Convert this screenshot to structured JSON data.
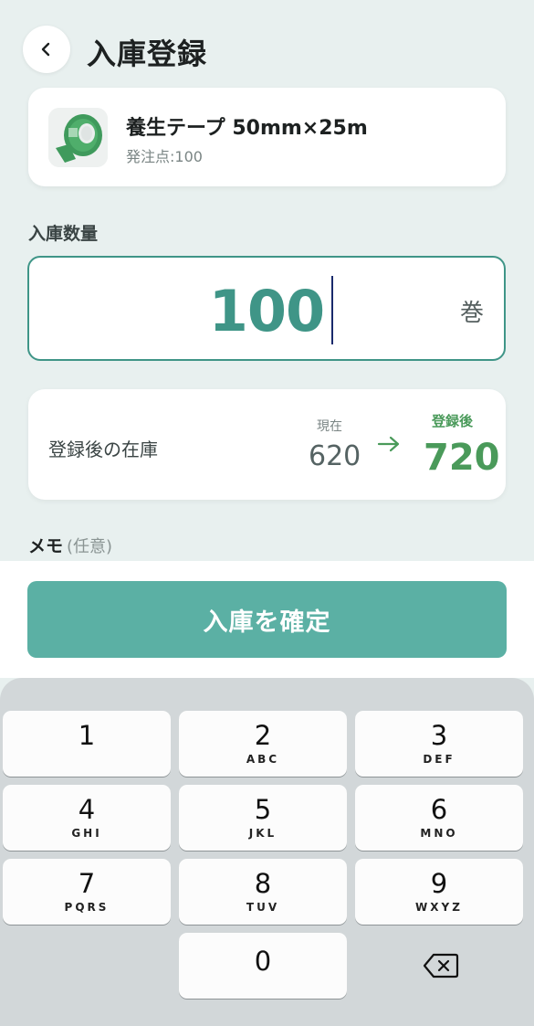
{
  "header": {
    "title": "入庫登録",
    "back_icon": "chevron-left-icon"
  },
  "product": {
    "name": "養生テープ 50mm×25m",
    "reorder_point": "発注点:100",
    "thumbnail_icon": "tape-roll-image",
    "thumbnail_color": "#3f9a5c"
  },
  "quantity": {
    "label": "入庫数量",
    "value": "100",
    "unit": "巻"
  },
  "stock": {
    "label": "登録後の在庫",
    "current_label": "現在",
    "current_value": "620",
    "after_label": "登録後",
    "after_value": "720",
    "arrow_icon": "arrow-right-icon"
  },
  "memo": {
    "label": "メモ",
    "optional": "(任意)"
  },
  "confirm": {
    "label": "入庫を確定"
  },
  "keypad": {
    "keys": [
      {
        "digit": "1",
        "letters": ""
      },
      {
        "digit": "2",
        "letters": "ABC"
      },
      {
        "digit": "3",
        "letters": "DEF"
      },
      {
        "digit": "4",
        "letters": "GHI"
      },
      {
        "digit": "5",
        "letters": "JKL"
      },
      {
        "digit": "6",
        "letters": "MNO"
      },
      {
        "digit": "7",
        "letters": "PQRS"
      },
      {
        "digit": "8",
        "letters": "TUV"
      },
      {
        "digit": "9",
        "letters": "WXYZ"
      },
      {
        "digit": "0",
        "letters": ""
      }
    ],
    "delete_icon": "backspace-icon"
  },
  "colors": {
    "accent": "#3f9587",
    "button": "#5bb0a4",
    "positive": "#4a9a5a",
    "background": "#e8f0ef"
  }
}
